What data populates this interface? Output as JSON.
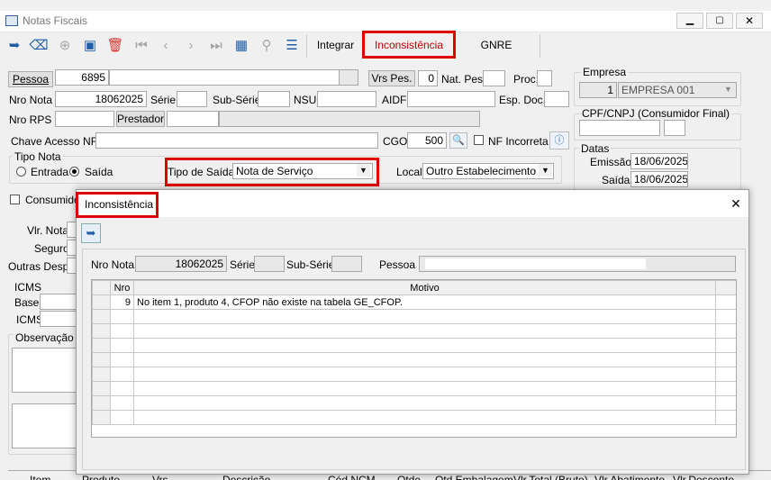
{
  "window": {
    "title": "Notas Fiscais"
  },
  "tabs": [
    "Integrar",
    "Inconsistência",
    "GNRE"
  ],
  "form": {
    "pessoa_label": "Pessoa",
    "pessoa_value": "6895",
    "vrs_pes_label": "Vrs Pes.",
    "vrs_pes_value": "0",
    "nat_pes_label": "Nat. Pes.",
    "proc_label": "Proc.",
    "nro_nota_label": "Nro Nota",
    "nro_nota_value": "18062025",
    "serie_label": "Série",
    "sub_serie_label": "Sub-Série",
    "nsu_label": "NSU",
    "aidf_label": "AIDF",
    "esp_doc_label": "Esp. Doc.",
    "nro_rps_label": "Nro RPS",
    "prestador_label": "Prestador",
    "chave_label": "Chave Acesso NFe",
    "cgo_label": "CGO",
    "cgo_value": "500",
    "nf_incorreta_label": "NF Incorreta",
    "tipo_nota_label": "Tipo Nota",
    "entrada_label": "Entrada",
    "saida_label": "Saída",
    "tipo_saida_label": "Tipo de Saída",
    "tipo_saida_value": "Nota de Serviço",
    "local_label": "Local",
    "local_value": "Outro Estabelecimento",
    "consumidor_label": "Consumido",
    "vlr_nota_label": "Vlr. Nota",
    "seguro_label": "Seguro",
    "outras_desp_label": "Outras Desp.",
    "icms_group": "ICMS",
    "base_label": "Base",
    "icms_label": "ICMS",
    "observacao_label": "Observação"
  },
  "empresa": {
    "label": "Empresa",
    "code": "1",
    "name": "EMPRESA 001",
    "cpf_label": "CPF/CNPJ (Consumidor Final)",
    "datas_label": "Datas",
    "emissao_label": "Emissão",
    "emissao_value": "18/06/2025",
    "saida_label": "Saída",
    "saida_value": "18/06/2025"
  },
  "items_header": [
    "Item",
    "Produto",
    "Vrs",
    "Descrição",
    "Cód.NCM",
    "Qtde",
    "Qtd.Embalagem",
    "Vlr.Total (Bruto)",
    "Vlr.Abatimento",
    "Vlr.Desconto"
  ],
  "dialog": {
    "title": "Inconsistência",
    "nro_nota_label": "Nro Nota",
    "nro_nota_value": "18062025",
    "serie_label": "Série",
    "sub_serie_label": "Sub-Série",
    "pessoa_label": "Pessoa",
    "col_nro": "Nro",
    "col_motivo": "Motivo",
    "rows": [
      {
        "nro": "9",
        "motivo": "No item 1, produto 4, CFOP  não existe na tabela GE_CFOP."
      }
    ]
  },
  "colors": {
    "highlight": "#e00000",
    "icon_blue": "#1f5fa8",
    "delete_red": "#d9342b"
  }
}
